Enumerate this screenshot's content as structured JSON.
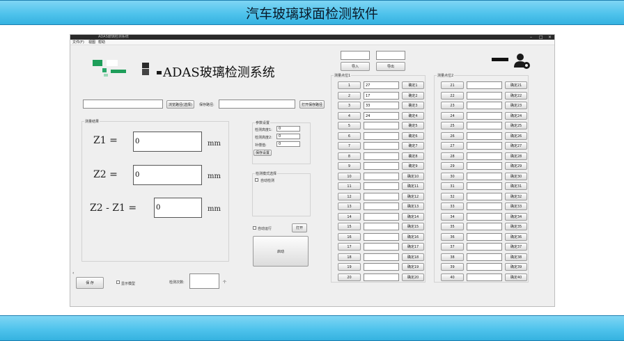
{
  "banner": {
    "title": "汽车玻璃球面检测软件"
  },
  "window": {
    "title": "ADAS玻璃检测系统",
    "menu": [
      "文件(F)",
      "视图",
      "帮助"
    ]
  },
  "header": {
    "title": "ADAS玻璃检测系统",
    "top_inputs": [
      "",
      ""
    ],
    "top_buttons": [
      "导入",
      "导出"
    ]
  },
  "path_row": {
    "input": "",
    "browse_button": "浏览路径(选择)",
    "label": "保存路径:",
    "input2": "",
    "open_button": "打开保存路径"
  },
  "result": {
    "group_title": "测量结果",
    "z1_label": "Z1  =",
    "z1_value": "0",
    "z2_label": "Z2  =",
    "z2_value": "0",
    "diff_label": "Z2 - Z1  =",
    "diff_value": "0",
    "unit": "mm"
  },
  "params": {
    "group_title": "参数设置",
    "rows": [
      {
        "label": "检测高度1:",
        "value": "0"
      },
      {
        "label": "检测高度2:",
        "value": "0"
      },
      {
        "label": "补偿值:",
        "value": "0"
      }
    ],
    "button": "保存设置"
  },
  "mode": {
    "group_title": "检测模式选择",
    "option": "自动检测"
  },
  "options": {
    "auto_label": "自动运行",
    "open_button": "打开",
    "start_button": "启动"
  },
  "bottom": {
    "save_button": "保 存",
    "check_label": "显示模型",
    "count_label": "检测次数:",
    "count_value": "",
    "unit": "个"
  },
  "left_table": {
    "title": "测量点位1",
    "rows": [
      {
        "idx": "1",
        "value": "27",
        "btn": "确定1"
      },
      {
        "idx": "2",
        "value": "17",
        "btn": "确定2"
      },
      {
        "idx": "3",
        "value": "33",
        "btn": "确定3"
      },
      {
        "idx": "4",
        "value": "24",
        "btn": "确定4"
      },
      {
        "idx": "5",
        "value": "",
        "btn": "确定5"
      },
      {
        "idx": "6",
        "value": "",
        "btn": "确定6"
      },
      {
        "idx": "7",
        "value": "",
        "btn": "确定7"
      },
      {
        "idx": "8",
        "value": "",
        "btn": "确定8"
      },
      {
        "idx": "9",
        "value": "",
        "btn": "确定9"
      },
      {
        "idx": "10",
        "value": "",
        "btn": "确定10"
      },
      {
        "idx": "11",
        "value": "",
        "btn": "确定11"
      },
      {
        "idx": "12",
        "value": "",
        "btn": "确定12"
      },
      {
        "idx": "13",
        "value": "",
        "btn": "确定13"
      },
      {
        "idx": "14",
        "value": "",
        "btn": "确定14"
      },
      {
        "idx": "15",
        "value": "",
        "btn": "确定15"
      },
      {
        "idx": "16",
        "value": "",
        "btn": "确定16"
      },
      {
        "idx": "17",
        "value": "",
        "btn": "确定17"
      },
      {
        "idx": "18",
        "value": "",
        "btn": "确定18"
      },
      {
        "idx": "19",
        "value": "",
        "btn": "确定19"
      },
      {
        "idx": "20",
        "value": "",
        "btn": "确定20"
      }
    ]
  },
  "right_table": {
    "title": "测量点位2",
    "rows": [
      {
        "idx": "21",
        "value": "",
        "btn": "确定21"
      },
      {
        "idx": "22",
        "value": "",
        "btn": "确定22"
      },
      {
        "idx": "23",
        "value": "",
        "btn": "确定23"
      },
      {
        "idx": "24",
        "value": "",
        "btn": "确定24"
      },
      {
        "idx": "25",
        "value": "",
        "btn": "确定25"
      },
      {
        "idx": "26",
        "value": "",
        "btn": "确定26"
      },
      {
        "idx": "27",
        "value": "",
        "btn": "确定27"
      },
      {
        "idx": "28",
        "value": "",
        "btn": "确定28"
      },
      {
        "idx": "29",
        "value": "",
        "btn": "确定29"
      },
      {
        "idx": "30",
        "value": "",
        "btn": "确定30"
      },
      {
        "idx": "31",
        "value": "",
        "btn": "确定31"
      },
      {
        "idx": "32",
        "value": "",
        "btn": "确定32"
      },
      {
        "idx": "33",
        "value": "",
        "btn": "确定33"
      },
      {
        "idx": "34",
        "value": "",
        "btn": "确定34"
      },
      {
        "idx": "35",
        "value": "",
        "btn": "确定35"
      },
      {
        "idx": "36",
        "value": "",
        "btn": "确定36"
      },
      {
        "idx": "37",
        "value": "",
        "btn": "确定37"
      },
      {
        "idx": "38",
        "value": "",
        "btn": "确定38"
      },
      {
        "idx": "39",
        "value": "",
        "btn": "确定39"
      },
      {
        "idx": "40",
        "value": "",
        "btn": "确定40"
      }
    ]
  },
  "colors": {
    "band": "#4fc3ec",
    "logo_green": "#1e9e5a",
    "window_bg": "#efefef"
  },
  "icons": {
    "user": "user-settings-icon"
  }
}
